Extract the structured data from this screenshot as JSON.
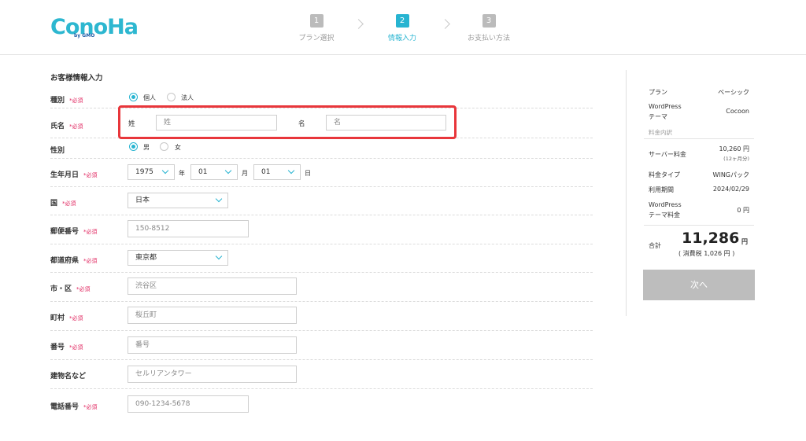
{
  "brand": {
    "logo_text": "ConoHa",
    "logo_sub": "by GMO"
  },
  "steps": [
    {
      "num": "1",
      "label": "プラン選択",
      "active": false
    },
    {
      "num": "2",
      "label": "情報入力",
      "active": true
    },
    {
      "num": "3",
      "label": "お支払い方法",
      "active": false
    }
  ],
  "form": {
    "title": "お客様情報入力",
    "required_mark": "*必須",
    "type": {
      "label": "種別",
      "options": [
        "個人",
        "法人"
      ],
      "selected": "個人"
    },
    "name": {
      "label": "氏名",
      "last_label": "姓",
      "last_placeholder": "姓",
      "first_label": "名",
      "first_placeholder": "名"
    },
    "gender": {
      "label": "性別",
      "options": [
        "男",
        "女"
      ],
      "selected": "男"
    },
    "birthday": {
      "label": "生年月日",
      "year": "1975",
      "year_unit": "年",
      "month": "01",
      "month_unit": "月",
      "day": "01",
      "day_unit": "日"
    },
    "country": {
      "label": "国",
      "value": "日本"
    },
    "postal": {
      "label": "郵便番号",
      "placeholder": "150-8512"
    },
    "prefecture": {
      "label": "都道府県",
      "value": "東京都"
    },
    "city": {
      "label": "市・区",
      "placeholder": "渋谷区"
    },
    "town": {
      "label": "町村",
      "placeholder": "桜丘町"
    },
    "number": {
      "label": "番号",
      "placeholder": "番号"
    },
    "building": {
      "label": "建物名など",
      "placeholder": "セルリアンタワー"
    },
    "phone": {
      "label": "電話番号",
      "placeholder": "090-1234-5678"
    }
  },
  "summary": {
    "plan_label": "プラン",
    "plan_value": "ベーシック",
    "theme_label_1": "WordPress",
    "theme_label_2": "テーマ",
    "theme_value": "Cocoon",
    "breakdown_label": "料金内訳",
    "server_label": "サーバー料金",
    "server_value": "10,260 円",
    "server_note": "(12ヶ月分)",
    "fee_type_label": "料金タイプ",
    "fee_type_value": "WINGパック",
    "period_label": "利用期間",
    "period_value": "2024/02/29",
    "theme_fee_label_1": "WordPress",
    "theme_fee_label_2": "テーマ料金",
    "theme_fee_value": "0 円",
    "total_label": "合計",
    "total_value": "11,286",
    "total_unit": "円",
    "tax": "( 消費税 1,026 円 )",
    "next_button": "次へ"
  },
  "colors": {
    "accent": "#27b4d1",
    "required": "#e0245e",
    "highlight": "#e8363b",
    "button_disabled": "#bdbdbd"
  }
}
